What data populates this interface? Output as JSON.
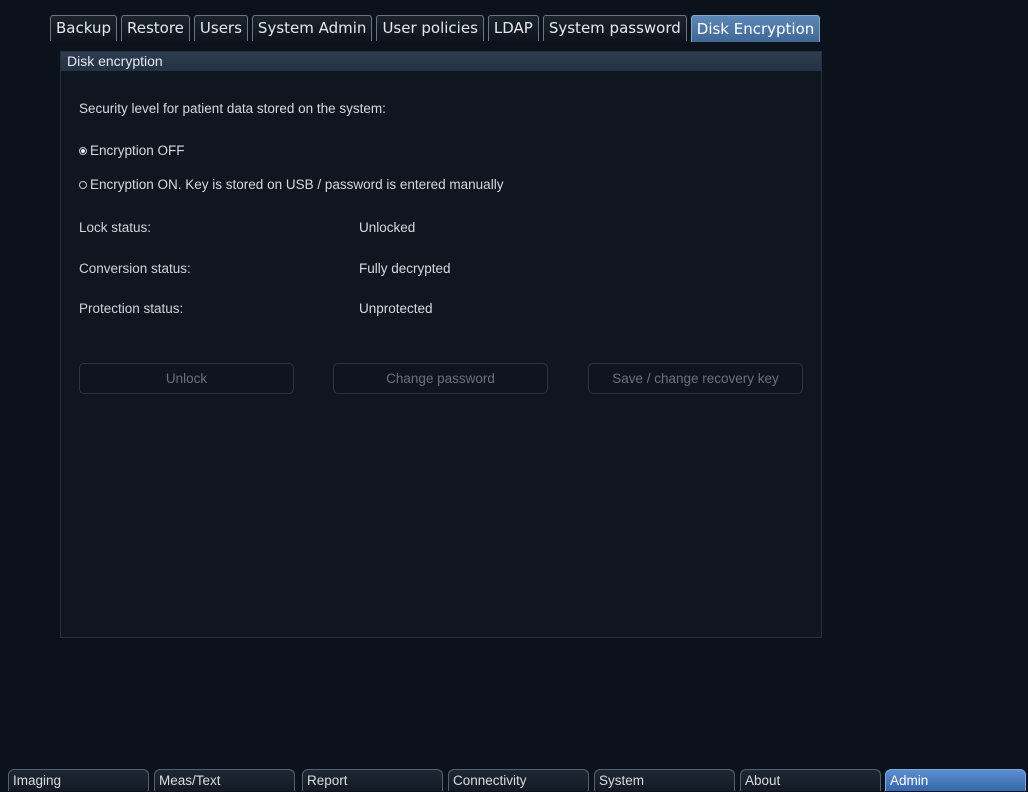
{
  "top_tabs": [
    {
      "label": "Backup",
      "active": false
    },
    {
      "label": "Restore",
      "active": false
    },
    {
      "label": "Users",
      "active": false
    },
    {
      "label": "System Admin",
      "active": false
    },
    {
      "label": "User policies",
      "active": false
    },
    {
      "label": "LDAP",
      "active": false
    },
    {
      "label": "System password",
      "active": false
    },
    {
      "label": "Disk Encryption",
      "active": true
    }
  ],
  "panel": {
    "title": "Disk encryption",
    "security_prompt": "Security level for patient data stored on the system:",
    "options": [
      {
        "label": "Encryption OFF",
        "selected": true
      },
      {
        "label": "Encryption ON. Key is stored on USB / password is entered manually",
        "selected": false
      }
    ],
    "status": [
      {
        "label": "Lock status:",
        "value": "Unlocked"
      },
      {
        "label": "Conversion status:",
        "value": "Fully decrypted"
      },
      {
        "label": "Protection status:",
        "value": "Unprotected"
      }
    ],
    "buttons": {
      "unlock": "Unlock",
      "change_password": "Change password",
      "recovery_key": "Save / change recovery key"
    }
  },
  "bottom_tabs": [
    {
      "label": "Imaging",
      "active": false
    },
    {
      "label": "Meas/Text",
      "active": false
    },
    {
      "label": "Report",
      "active": false
    },
    {
      "label": "Connectivity",
      "active": false
    },
    {
      "label": "System",
      "active": false
    },
    {
      "label": "About",
      "active": false
    },
    {
      "label": "Admin",
      "active": true
    }
  ],
  "colors": {
    "background": "#0c121b",
    "active_tab": "#4f78a8",
    "active_bottom_tab": "#4a7cc0",
    "disabled_text": "#69717b"
  }
}
